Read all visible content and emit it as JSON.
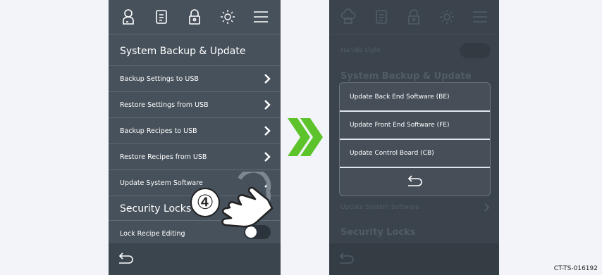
{
  "left_screen": {
    "section_title": "System Backup & Update",
    "rows": [
      {
        "label": "Backup Settings to USB"
      },
      {
        "label": "Restore Settings from USB"
      },
      {
        "label": "Backup Recipes to USB"
      },
      {
        "label": "Restore Recipes from USB"
      },
      {
        "label": "Update System Software"
      }
    ],
    "security_title": "Security Locks",
    "lock_recipe_label": "Lock Recipe Editing",
    "lock_recipe_toggle": "off",
    "step_number": "④"
  },
  "right_screen": {
    "handle_light_label": "Handle Light",
    "section_title": "System Backup & Update",
    "modal_options": [
      {
        "label": "Update Back End Software (BE)"
      },
      {
        "label": "Update Front End Software (FE)"
      },
      {
        "label": "Update Control Board (CB)"
      }
    ],
    "update_label": "Update System Software",
    "security_title": "Security Locks"
  },
  "caption": "CT-TS-016192",
  "colors": {
    "accent_green": "#5cc32a",
    "panel_bg": "#47515b"
  }
}
